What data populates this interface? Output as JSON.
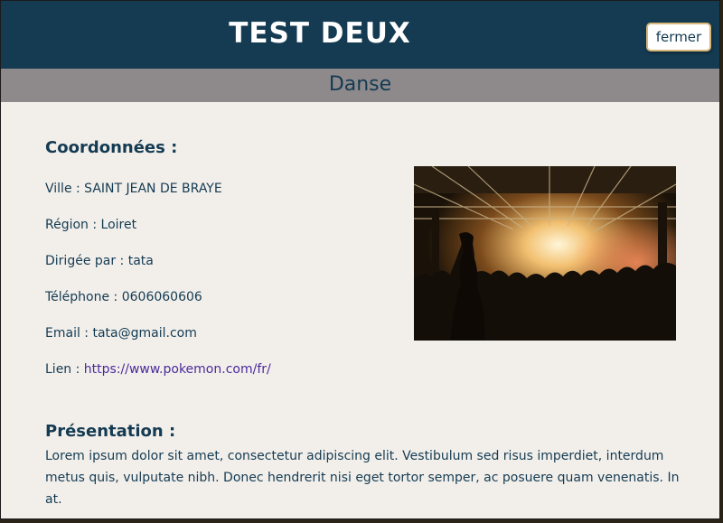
{
  "header": {
    "title": "TEST DEUX",
    "close_label": "fermer"
  },
  "category": "Danse",
  "contact": {
    "heading": "Coordonnées :",
    "city_label": "Ville :",
    "city": "SAINT JEAN DE BRAYE",
    "region_label": "Région :",
    "region": "Loiret",
    "director_label": "Dirigée par :",
    "director": "tata",
    "phone_label": "Téléphone :",
    "phone": "0606060606",
    "email_label": "Email :",
    "email": "tata@gmail.com",
    "link_label": "Lien :",
    "link": "https://www.pokemon.com/fr/"
  },
  "presentation": {
    "heading": "Présentation :",
    "text": "Lorem ipsum dolor sit amet, consectetur adipiscing elit. Vestibulum sed risus imperdiet, interdum metus quis, vulputate nibh. Donec hendrerit nisi eget tortor semper, ac posuere quam venenatis. In at."
  },
  "colors": {
    "header_bg": "#143b52",
    "subheader_bg": "#8e8a8c",
    "panel_bg": "#f2efeb",
    "link": "#4b2a9a"
  },
  "image": {
    "subject": "concert crowd photo"
  }
}
